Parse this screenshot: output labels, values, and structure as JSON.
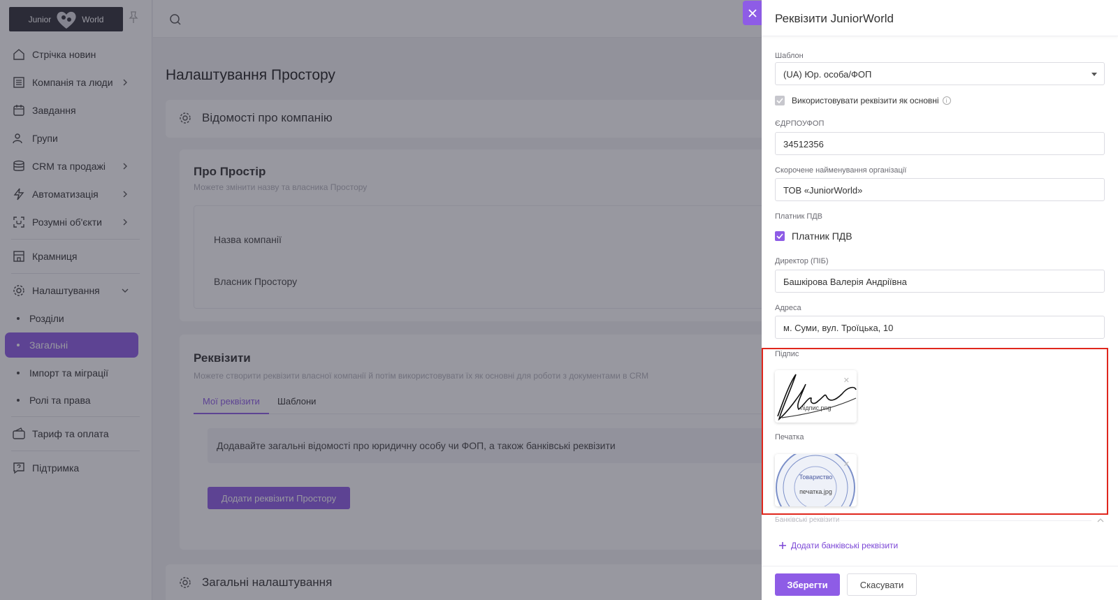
{
  "logo": {
    "left": "Junior",
    "right": "World"
  },
  "sidebar": {
    "items": [
      {
        "label": "Стрічка новин"
      },
      {
        "label": "Компанія та люди"
      },
      {
        "label": "Завдання"
      },
      {
        "label": "Групи"
      },
      {
        "label": "CRM та продажі"
      },
      {
        "label": "Автоматизація"
      },
      {
        "label": "Розумні об'єкти"
      },
      {
        "label": "Крамниця"
      },
      {
        "label": "Налаштування"
      }
    ],
    "sub_items": [
      {
        "label": "Розділи"
      },
      {
        "label": "Загальні"
      },
      {
        "label": "Імпорт та міграції"
      },
      {
        "label": "Ролі та права"
      }
    ],
    "bottom_items": [
      {
        "label": "Тариф та оплата"
      },
      {
        "label": "Підтримка"
      }
    ]
  },
  "main": {
    "page_title": "Налаштування Простору",
    "company_section": "Відомості про компанію",
    "about": {
      "title": "Про Простір",
      "subtitle": "Можете змінити назву та власника Простору",
      "company_name_label": "Назва компанії",
      "owner_label": "Власник Простору"
    },
    "requisites": {
      "title": "Реквізити",
      "subtitle": "Можете створити реквізити власної компанії й потім використовувати їх як основні для роботи з документами в CRM",
      "tabs": [
        "Мої реквізити",
        "Шаблони"
      ],
      "info": "Додавайте загальні відомості про юридичну особу чи ФОП, а також банківські реквізити",
      "add_button": "Додати реквізити Простору"
    },
    "general_section": "Загальні налаштування"
  },
  "drawer": {
    "title": "Реквізити JuniorWorld",
    "template_label": "Шаблон",
    "template_value": "(UA) Юр. особа/ФОП",
    "use_as_main": "Використовувати реквізити як основні",
    "edrpou_label": "ЄДРПОУФОП",
    "edrpou_value": "34512356",
    "short_name_label": "Скорочене найменування організації",
    "short_name_value": "ТОВ «JuniorWorld»",
    "vat_label": "Платник ПДВ",
    "vat_checkbox": "Платник ПДВ",
    "director_label": "Директор (ПІБ)",
    "director_value": "Башкірова Валерія Андріївна",
    "address_label": "Адреса",
    "address_value": "м. Суми, вул. Троїцька, 10",
    "signature_label": "Підпис",
    "signature_file": "підпис.png",
    "stamp_label": "Печатка",
    "stamp_file": "печатка.jpg",
    "stamp_text": "Товариство",
    "bank_label": "Банківські реквізити",
    "add_bank": "Додати банківські реквізити",
    "save": "Зберегти",
    "cancel": "Скасувати"
  },
  "colors": {
    "accent": "#8e5ce6",
    "highlight": "#e0261c"
  }
}
